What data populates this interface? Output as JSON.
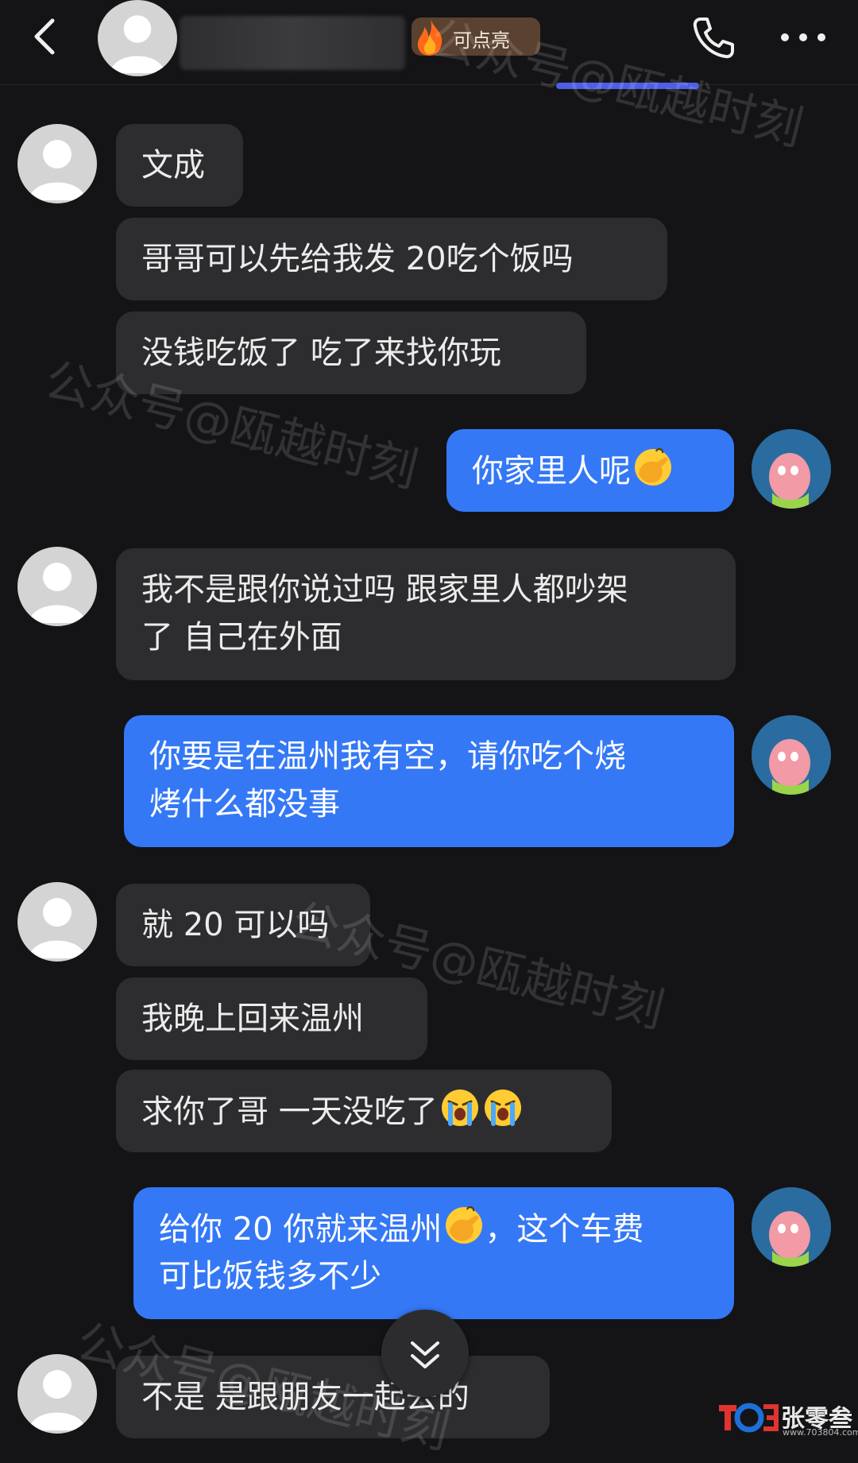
{
  "header": {
    "badge_label": "可点亮",
    "icons": [
      "back-icon",
      "flame-icon",
      "phone-icon",
      "more-icon"
    ]
  },
  "messages": [
    {
      "side": "in",
      "text": "文成"
    },
    {
      "side": "in",
      "text": "哥哥可以先给我发 20吃个饭吗"
    },
    {
      "side": "in",
      "text": "没钱吃饭了 吃了来找你玩"
    },
    {
      "side": "out",
      "text": "你家里人呢",
      "emoji": "facepalm-emoji"
    },
    {
      "side": "in",
      "lines": [
        "我不是跟你说过吗 跟家里人都吵架",
        "了 自己在外面"
      ]
    },
    {
      "side": "out",
      "lines": [
        "你要是在温州我有空，请你吃个烧",
        "烤什么都没事"
      ]
    },
    {
      "side": "in",
      "text": "就 20 可以吗"
    },
    {
      "side": "in",
      "text": "我晚上回来温州"
    },
    {
      "side": "in",
      "text": "求你了哥 一天没吃了",
      "emoji": "crying-emoji x2"
    },
    {
      "side": "out",
      "lines": [
        "给你 20 你就来温州",
        "，这个车费",
        "可比饭钱多不少"
      ],
      "emoji": "facepalm-emoji"
    },
    {
      "side": "in",
      "text": "不是 是跟朋友一起去的"
    }
  ],
  "watermark": "公众号@瓯越时刻",
  "corner_logo": {
    "brand": "张零叁",
    "site": "www.703804.com"
  },
  "colors": {
    "background": "#141416",
    "incoming_bubble": "#2d2d30",
    "outgoing_bubble": "#3478f6"
  }
}
